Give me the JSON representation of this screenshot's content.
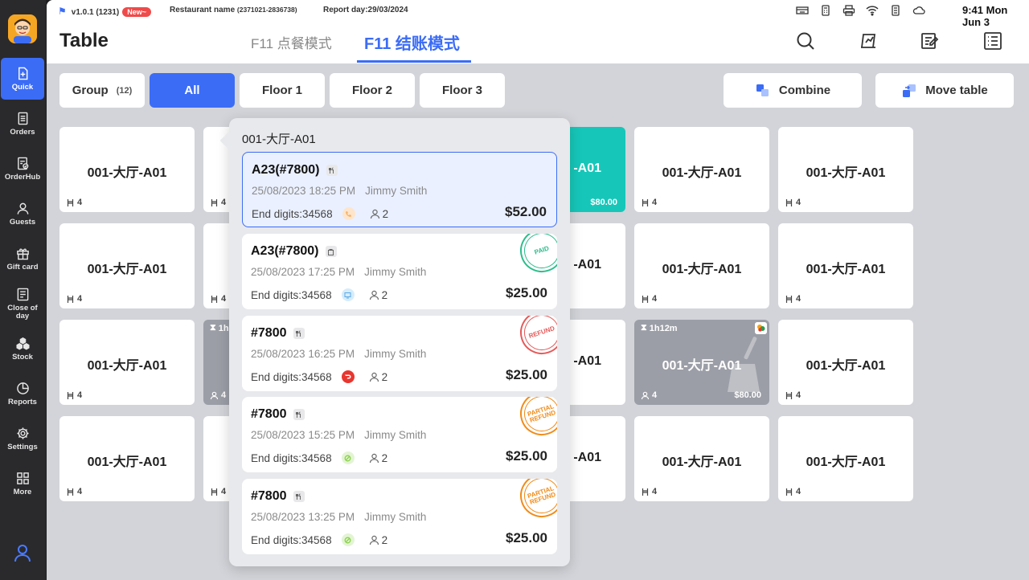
{
  "status_bar": {
    "version": "v1.0.1 (1231)",
    "new_badge": "New~",
    "restaurant_label": "Restaurant name",
    "restaurant_id": "(2371021-2836738)",
    "report_day": "Report day:29/03/2024",
    "clock": "9:41  Mon Jun 3"
  },
  "sidebar": {
    "items": [
      {
        "label": "Quick",
        "icon": "quick-icon"
      },
      {
        "label": "Orders",
        "icon": "orders-icon"
      },
      {
        "label": "OrderHub",
        "icon": "orderhub-icon"
      },
      {
        "label": "Guests",
        "icon": "guests-icon"
      },
      {
        "label": "Gift card",
        "icon": "gift-icon"
      },
      {
        "label": "Close of day",
        "icon": "close-day-icon"
      },
      {
        "label": "Stock",
        "icon": "stock-icon"
      },
      {
        "label": "Reports",
        "icon": "reports-icon"
      },
      {
        "label": "Settings",
        "icon": "gear-icon"
      },
      {
        "label": "More",
        "icon": "grid-icon"
      }
    ]
  },
  "header": {
    "title": "Table",
    "tabs": [
      {
        "label": "F11 点餐模式",
        "active": false
      },
      {
        "label": "F11 结账模式",
        "active": true
      }
    ]
  },
  "filters": {
    "group_label": "Group",
    "group_count": "(12)",
    "all": "All",
    "floors": [
      "Floor 1",
      "Floor 2",
      "Floor 3"
    ],
    "combine": "Combine",
    "move_table": "Move table"
  },
  "tables": {
    "name": "001-大厅-A01",
    "partial_name": "-A01",
    "seats": "4",
    "teal_amount": "$80.00",
    "gray_timer": "1h12m",
    "gray_amount": "$80.00",
    "left_gray_timer": "1h"
  },
  "popup": {
    "title": "001-大厅-A01",
    "orders": [
      {
        "name": "A23(#7800)",
        "datetime": "25/08/2023 18:25 PM",
        "staff": "Jimmy Smith",
        "digits": "End digits:34568",
        "guests": "2",
        "price": "$52.00",
        "stamp": "",
        "source_color": "#f4b36b",
        "type_icon": "dine-in-icon"
      },
      {
        "name": "A23(#7800)",
        "datetime": "25/08/2023 17:25 PM",
        "staff": "Jimmy Smith",
        "digits": "End digits:34568",
        "guests": "2",
        "price": "$25.00",
        "stamp": "PAID",
        "source_color": "#5aa9e6",
        "type_icon": "takeout-icon"
      },
      {
        "name": "#7800",
        "datetime": "25/08/2023 16:25 PM",
        "staff": "Jimmy Smith",
        "digits": "End digits:34568",
        "guests": "2",
        "price": "$25.00",
        "stamp": "REFUND",
        "source_color": "#e8362f",
        "type_icon": "dine-in-icon"
      },
      {
        "name": "#7800",
        "datetime": "25/08/2023 15:25 PM",
        "staff": "Jimmy Smith",
        "digits": "End digits:34568",
        "guests": "2",
        "price": "$25.00",
        "stamp": "PARTIAL REFUND",
        "source_color": "#8ad04a",
        "type_icon": "dine-in-icon"
      },
      {
        "name": "#7800",
        "datetime": "25/08/2023 13:25 PM",
        "staff": "Jimmy Smith",
        "digits": "End digits:34568",
        "guests": "2",
        "price": "$25.00",
        "stamp": "PARTIAL REFUND",
        "source_color": "#8ad04a",
        "type_icon": "dine-in-icon"
      }
    ]
  },
  "colors": {
    "accent": "#3b6cf6",
    "teal": "#16c7b9",
    "occupied": "#9c9ea7",
    "paid": "#2dbd8c",
    "refund": "#e45a5a",
    "partial_refund": "#f08c1a"
  }
}
